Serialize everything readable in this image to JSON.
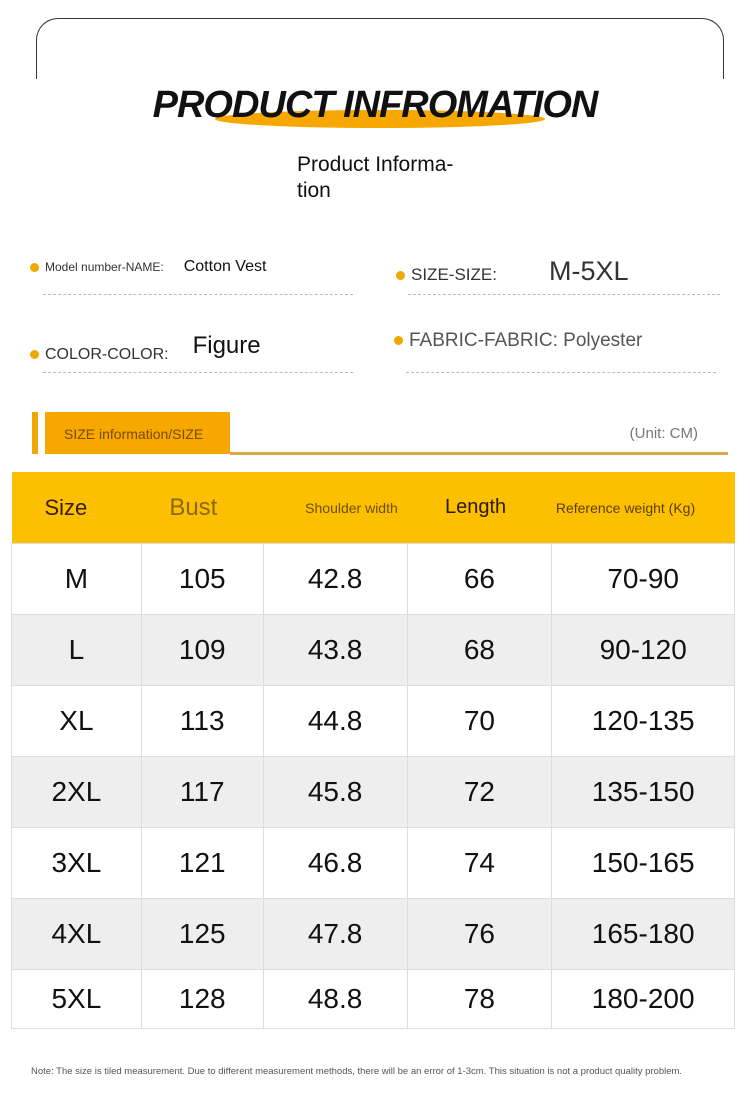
{
  "header": {
    "title": "PRODUCT INFROMATION",
    "subtitle": "Product Informa-tion"
  },
  "fields": [
    {
      "label": "Model number-NAME:",
      "value": "Cotton Vest"
    },
    {
      "label": "SIZE-SIZE:",
      "value": "M-5XL"
    },
    {
      "label": "COLOR-COLOR:",
      "value": "Figure"
    },
    {
      "label": "FABRIC-FABRIC:",
      "value": "Polyester"
    }
  ],
  "size_section": {
    "tab": "SIZE information/SIZE",
    "unit": "(Unit: CM)"
  },
  "table": {
    "headers": [
      "Size",
      "Bust",
      "Shoulder width",
      "Length",
      "Reference weight (Kg)"
    ],
    "rows": [
      [
        "M",
        "105",
        "42.8",
        "66",
        "70-90"
      ],
      [
        "L",
        "109",
        "43.8",
        "68",
        "90-120"
      ],
      [
        "XL",
        "113",
        "44.8",
        "70",
        "120-135"
      ],
      [
        "2XL",
        "117",
        "45.8",
        "72",
        "135-150"
      ],
      [
        "3XL",
        "121",
        "46.8",
        "74",
        "150-165"
      ],
      [
        "4XL",
        "125",
        "47.8",
        "76",
        "165-180"
      ],
      [
        "5XL",
        "128",
        "48.8",
        "78",
        "180-200"
      ]
    ]
  },
  "note": "Note: The size is tiled measurement. Due to different measurement methods, there will be an error of 1-3cm. This situation is not a product quality problem.",
  "colors": {
    "accent": "#f6a800",
    "header_bg": "#fcc000"
  }
}
